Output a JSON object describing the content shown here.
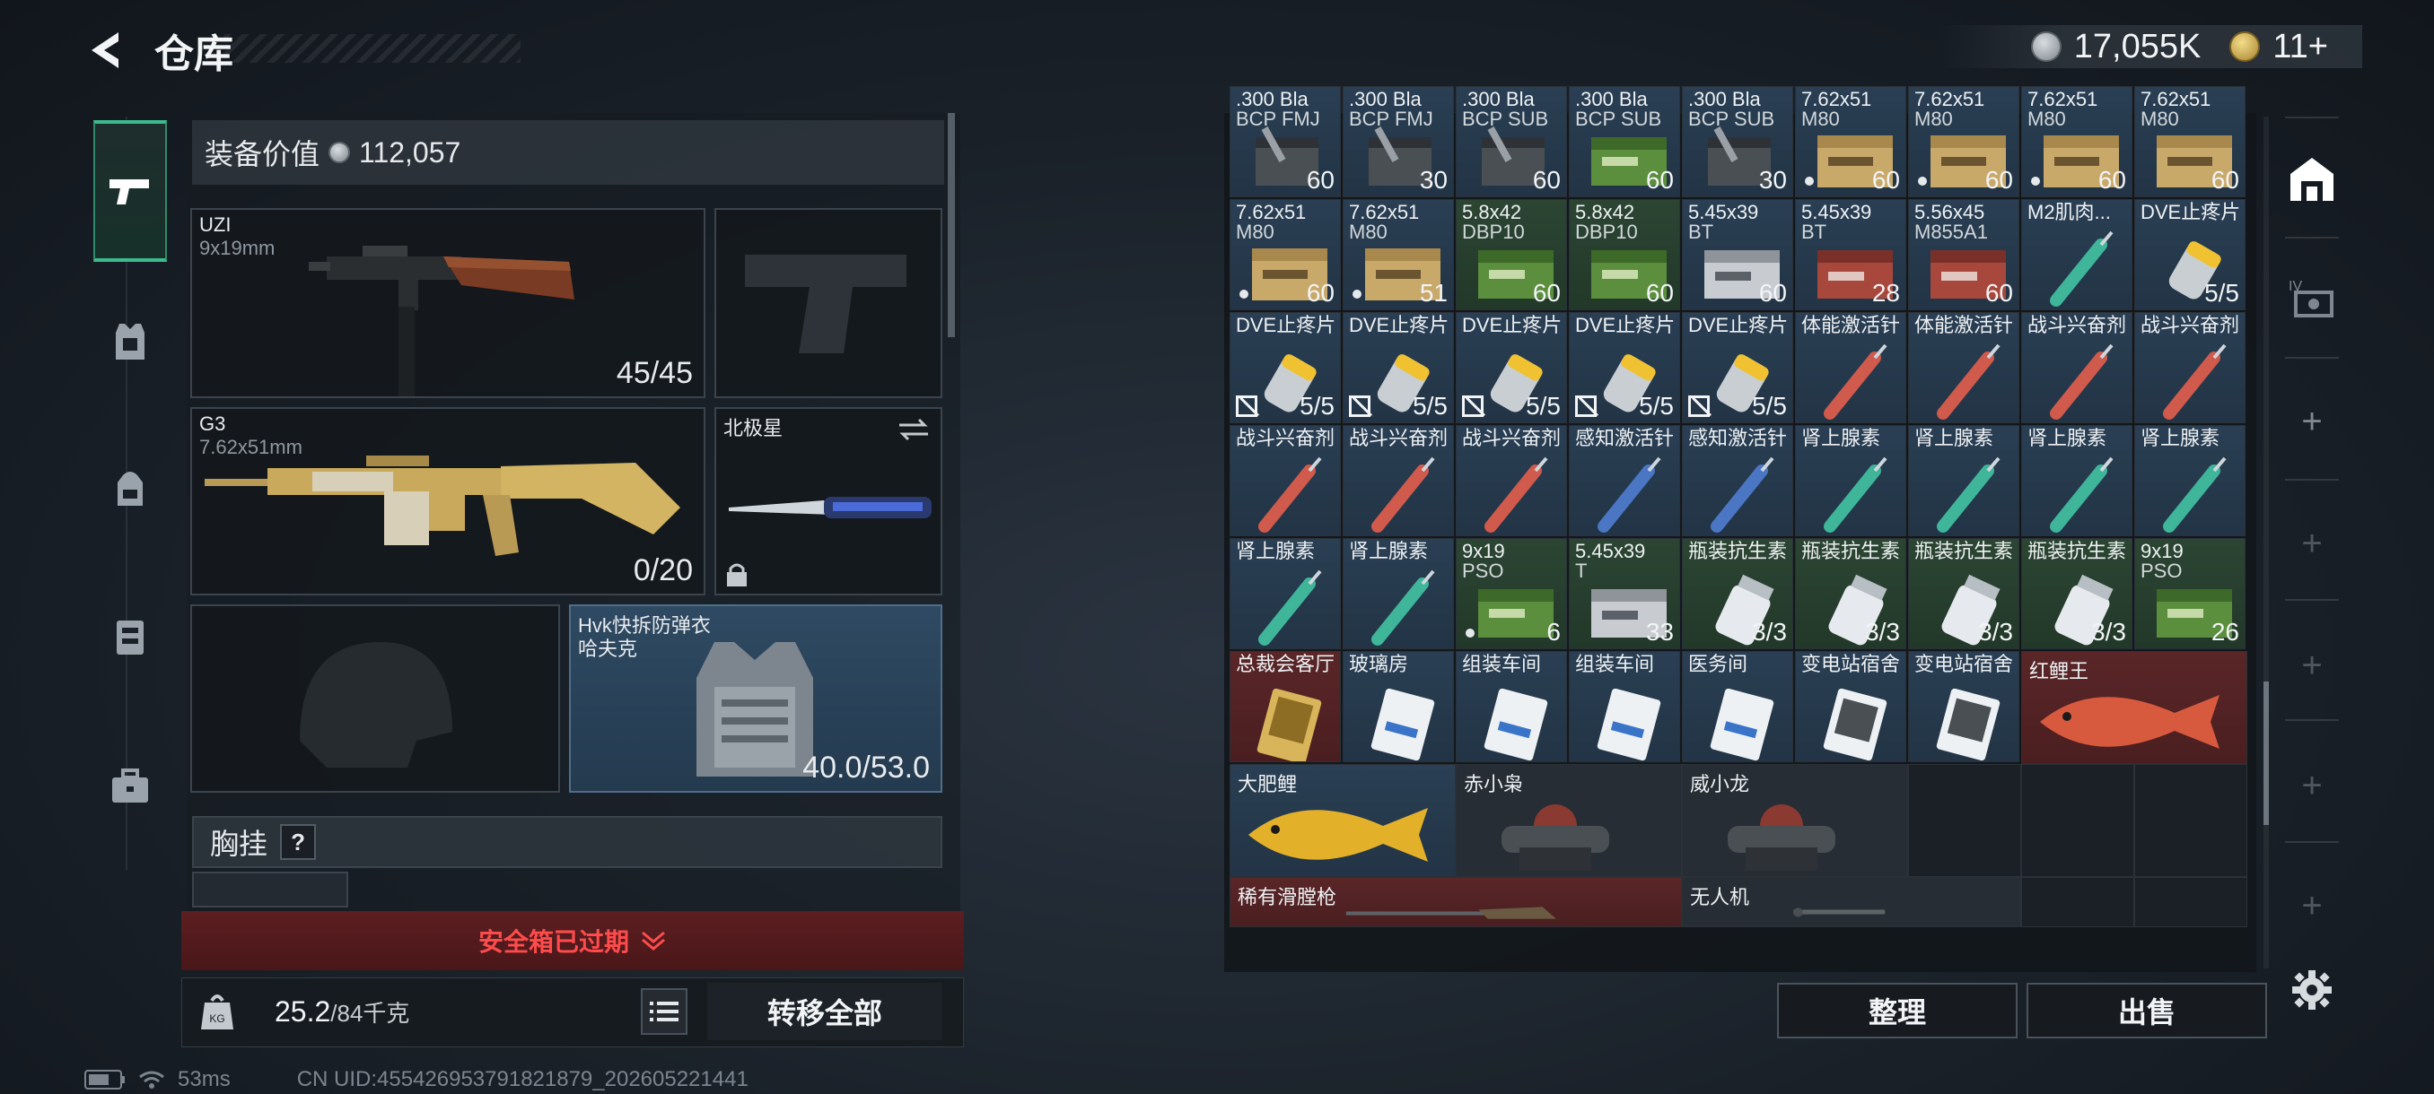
{
  "header": {
    "title": "仓库"
  },
  "currency": [
    {
      "icon": "silver-coin-icon",
      "value": "17,055K"
    },
    {
      "icon": "gold-coin-icon",
      "value": "11+"
    }
  ],
  "loadout": {
    "value_label": "装备价值",
    "value": "112,057",
    "primary": {
      "name": "UZI",
      "caliber": "9x19mm",
      "ammo": "45/45"
    },
    "secondary": {
      "name": "G3",
      "caliber": "7.62x51mm",
      "ammo": "0/20"
    },
    "melee": {
      "name": "北极星"
    },
    "armor": {
      "name": "Hvk快拆防弹衣",
      "sub": "哈夫克",
      "durability": "40.0/53.0"
    },
    "chest_label": "胸挂",
    "chest_help": "?",
    "safe_box": "安全箱已过期",
    "weight": "25.2",
    "weight_cap": "/84千克",
    "transfer_all": "转移全部"
  },
  "status": {
    "ping": "53ms",
    "uid": "CN UID:455426953791821879_202605221441"
  },
  "inventory": {
    "rows": [
      [
        {
          "n": ".300 Bla",
          "s": "BCP FMJ",
          "c": "60",
          "bg": "blue",
          "art": "ammo-dark"
        },
        {
          "n": ".300 Bla",
          "s": "BCP FMJ",
          "c": "30",
          "bg": "blue",
          "art": "ammo-dark"
        },
        {
          "n": ".300 Bla",
          "s": "BCP SUB",
          "c": "60",
          "bg": "blue",
          "art": "ammo-dark"
        },
        {
          "n": ".300 Bla",
          "s": "BCP SUB",
          "c": "60",
          "bg": "blue",
          "art": "ammo-green"
        },
        {
          "n": ".300 Bla",
          "s": "BCP SUB",
          "c": "30",
          "bg": "blue",
          "art": "ammo-dark"
        },
        {
          "n": "7.62x51",
          "s": "M80",
          "c": "60",
          "bg": "blue",
          "art": "ammo-box",
          "dot": true
        },
        {
          "n": "7.62x51",
          "s": "M80",
          "c": "60",
          "bg": "blue",
          "art": "ammo-box",
          "dot": true
        },
        {
          "n": "7.62x51",
          "s": "M80",
          "c": "60",
          "bg": "blue",
          "art": "ammo-box",
          "dot": true
        },
        {
          "n": "7.62x51",
          "s": "M80",
          "c": "60",
          "bg": "blue",
          "art": "ammo-box"
        }
      ],
      [
        {
          "n": "7.62x51",
          "s": "M80",
          "c": "60",
          "bg": "blue",
          "art": "ammo-box",
          "dot": true
        },
        {
          "n": "7.62x51",
          "s": "M80",
          "c": "51",
          "bg": "blue",
          "art": "ammo-box",
          "dot": true
        },
        {
          "n": "5.8x42",
          "s": "DBP10",
          "c": "60",
          "bg": "green",
          "art": "ammo-green"
        },
        {
          "n": "5.8x42",
          "s": "DBP10",
          "c": "60",
          "bg": "green",
          "art": "ammo-green"
        },
        {
          "n": "5.45x39",
          "s": "BT",
          "c": "60",
          "bg": "blue",
          "art": "ammo-gray"
        },
        {
          "n": "5.45x39",
          "s": "BT",
          "c": "28",
          "bg": "blue",
          "art": "ammo-red"
        },
        {
          "n": "5.56x45",
          "s": "M855A1",
          "c": "60",
          "bg": "blue",
          "art": "ammo-red"
        },
        {
          "n": "M2肌肉...",
          "s": "",
          "c": "",
          "bg": "blue",
          "art": "syringe-green"
        },
        {
          "n": "DVE止疼片",
          "s": "",
          "c": "5/5",
          "bg": "blue",
          "art": "pills"
        }
      ],
      [
        {
          "n": "DVE止疼片",
          "s": "",
          "c": "5/5",
          "bg": "blue",
          "art": "pills",
          "flag": true
        },
        {
          "n": "DVE止疼片",
          "s": "",
          "c": "5/5",
          "bg": "blue",
          "art": "pills",
          "flag": true
        },
        {
          "n": "DVE止疼片",
          "s": "",
          "c": "5/5",
          "bg": "blue",
          "art": "pills",
          "flag": true
        },
        {
          "n": "DVE止疼片",
          "s": "",
          "c": "5/5",
          "bg": "blue",
          "art": "pills",
          "flag": true
        },
        {
          "n": "DVE止疼片",
          "s": "",
          "c": "5/5",
          "bg": "blue",
          "art": "pills",
          "flag": true
        },
        {
          "n": "体能激活针",
          "s": "",
          "c": "",
          "bg": "blue",
          "art": "syringe-red"
        },
        {
          "n": "体能激活针",
          "s": "",
          "c": "",
          "bg": "blue",
          "art": "syringe-red"
        },
        {
          "n": "战斗兴奋剂",
          "s": "",
          "c": "",
          "bg": "blue",
          "art": "syringe-red"
        },
        {
          "n": "战斗兴奋剂",
          "s": "",
          "c": "",
          "bg": "blue",
          "art": "syringe-red"
        }
      ],
      [
        {
          "n": "战斗兴奋剂",
          "s": "",
          "c": "",
          "bg": "blue",
          "art": "syringe-red"
        },
        {
          "n": "战斗兴奋剂",
          "s": "",
          "c": "",
          "bg": "blue",
          "art": "syringe-red"
        },
        {
          "n": "战斗兴奋剂",
          "s": "",
          "c": "",
          "bg": "blue",
          "art": "syringe-red"
        },
        {
          "n": "感知激活针",
          "s": "",
          "c": "",
          "bg": "blue",
          "art": "syringe-blue"
        },
        {
          "n": "感知激活针",
          "s": "",
          "c": "",
          "bg": "blue",
          "art": "syringe-blue"
        },
        {
          "n": "肾上腺素",
          "s": "",
          "c": "",
          "bg": "blue",
          "art": "syringe-green"
        },
        {
          "n": "肾上腺素",
          "s": "",
          "c": "",
          "bg": "blue",
          "art": "syringe-green"
        },
        {
          "n": "肾上腺素",
          "s": "",
          "c": "",
          "bg": "blue",
          "art": "syringe-green"
        },
        {
          "n": "肾上腺素",
          "s": "",
          "c": "",
          "bg": "blue",
          "art": "syringe-green"
        }
      ],
      [
        {
          "n": "肾上腺素",
          "s": "",
          "c": "",
          "bg": "blue",
          "art": "syringe-green"
        },
        {
          "n": "肾上腺素",
          "s": "",
          "c": "",
          "bg": "blue",
          "art": "syringe-green"
        },
        {
          "n": "9x19",
          "s": "PSO",
          "c": "6",
          "bg": "green",
          "art": "ammo-green",
          "dot": true
        },
        {
          "n": "5.45x39",
          "s": "T",
          "c": "33",
          "bg": "green",
          "art": "ammo-gray"
        },
        {
          "n": "瓶装抗生素",
          "s": "",
          "c": "3/3",
          "bg": "green",
          "art": "bottle"
        },
        {
          "n": "瓶装抗生素",
          "s": "",
          "c": "3/3",
          "bg": "green",
          "art": "bottle"
        },
        {
          "n": "瓶装抗生素",
          "s": "",
          "c": "3/3",
          "bg": "green",
          "art": "bottle"
        },
        {
          "n": "瓶装抗生素",
          "s": "",
          "c": "3/3",
          "bg": "green",
          "art": "bottle"
        },
        {
          "n": "9x19",
          "s": "PSO",
          "c": "26",
          "bg": "green",
          "art": "ammo-green"
        }
      ],
      [
        {
          "n": "总裁会客厅",
          "s": "",
          "c": "",
          "bg": "red",
          "art": "keycard-gold"
        },
        {
          "n": "玻璃房",
          "s": "",
          "c": "",
          "bg": "blue",
          "art": "keycard"
        },
        {
          "n": "组装车间",
          "s": "",
          "c": "",
          "bg": "blue",
          "art": "keycard"
        },
        {
          "n": "组装车间",
          "s": "",
          "c": "",
          "bg": "blue",
          "art": "keycard"
        },
        {
          "n": "医务间",
          "s": "",
          "c": "",
          "bg": "blue",
          "art": "keycard"
        },
        {
          "n": "变电站宿舍",
          "s": "",
          "c": "",
          "bg": "blue",
          "art": "keycard-dark"
        },
        {
          "n": "变电站宿舍",
          "s": "",
          "c": "",
          "bg": "blue",
          "art": "keycard-dark"
        }
      ]
    ],
    "large": [
      {
        "n": "红鲤王",
        "bg": "red",
        "art": "fish-red"
      },
      {
        "n": "大肥鲤",
        "bg": "blue",
        "art": "fish-gold"
      },
      {
        "n": "赤小枭",
        "bg": "gray",
        "art": "figure"
      },
      {
        "n": "威小龙",
        "bg": "gray",
        "art": "figure"
      },
      {
        "n": "稀有滑膛枪",
        "bg": "red",
        "art": "musket"
      },
      {
        "n": "无人机",
        "bg": "gray",
        "art": "drone"
      }
    ],
    "sort_button": "整理",
    "sell_button": "出售"
  },
  "colors": {
    "accent_green": "#3dbb8d",
    "warning_red": "#ff4b4b",
    "rarity_red": "#5a2628",
    "rarity_blue": "#2a3f54",
    "rarity_green": "#2c4533"
  }
}
